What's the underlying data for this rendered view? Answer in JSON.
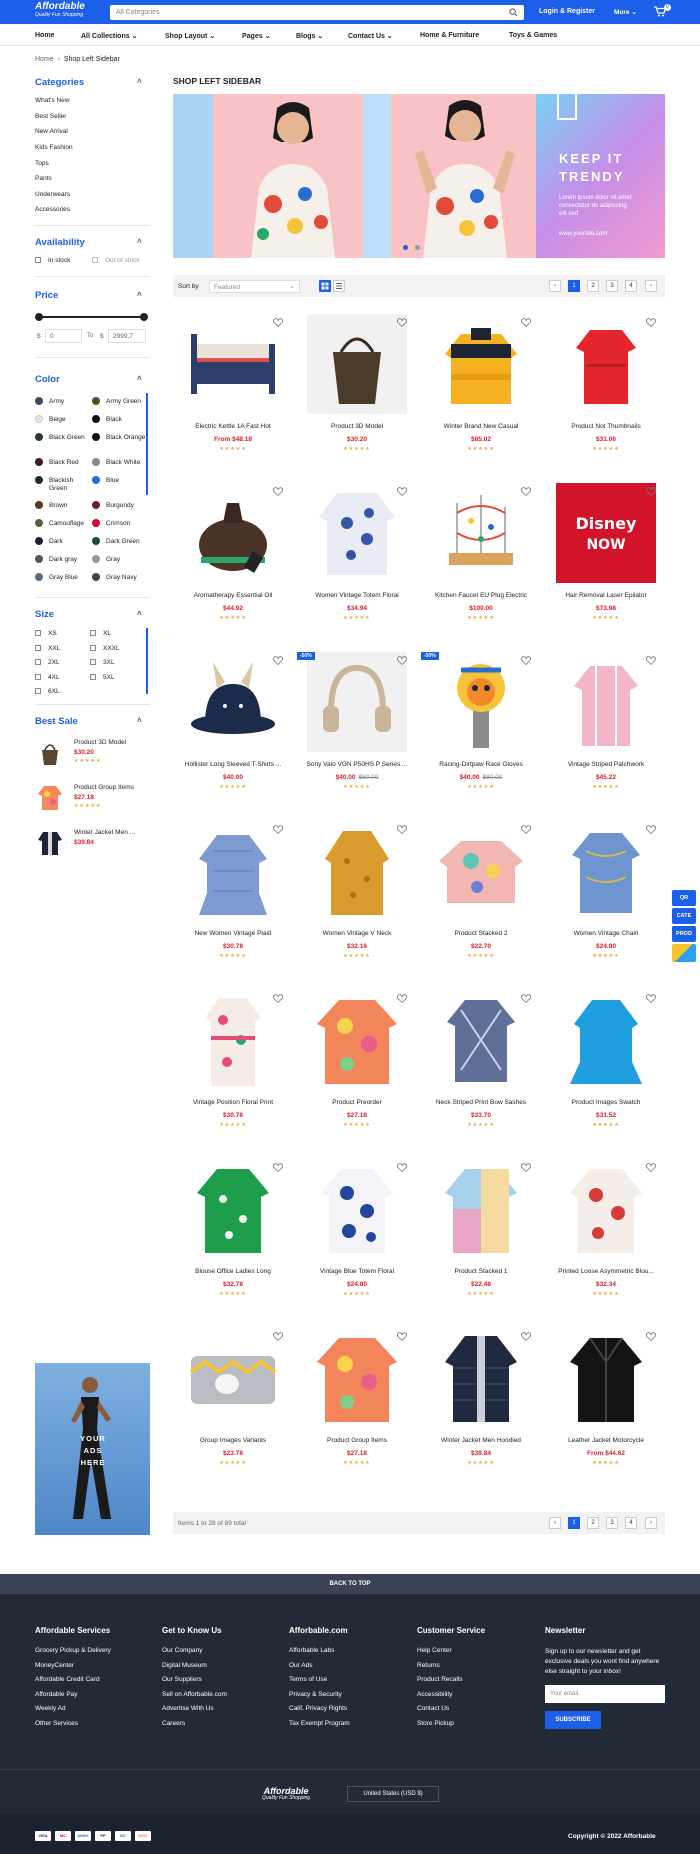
{
  "header": {
    "logo": "Affordable",
    "tagline": "Quality Fun Shopping",
    "search_placeholder": "All Categories",
    "login": "Login & Register",
    "more": "More",
    "cart_count": "0"
  },
  "nav": [
    "Home",
    "All Collections",
    "Shop Layout",
    "Pages",
    "Blogs",
    "Contact Us",
    "Home & Furniture",
    "Toys & Games"
  ],
  "breadcrumb": {
    "home": "Home",
    "current": "Shop Left Sidebar"
  },
  "sidebar": {
    "categories_title": "Categories",
    "categories": [
      "What's New",
      "Best Seller",
      "New Arrival",
      "Kids Fashion",
      "Tops",
      "Pants",
      "Underwears",
      "Accessories"
    ],
    "availability_title": "Availability",
    "in_stock": "In stock",
    "out_of_stock": "Out of stock",
    "price_title": "Price",
    "price_min": "0",
    "price_to": "To",
    "price_max": "2999,7",
    "currency": "$",
    "color_title": "Color",
    "colors": [
      {
        "name": "Army",
        "hex": "#3c4a60"
      },
      {
        "name": "Army Green",
        "hex": "#4b5320"
      },
      {
        "name": "Beige",
        "hex": "#efe3d6"
      },
      {
        "name": "Black",
        "hex": "#111111"
      },
      {
        "name": "Black Green",
        "hex": "#2c3a35"
      },
      {
        "name": "Black Orange",
        "hex": "#111111"
      },
      {
        "name": "Black Red",
        "hex": "#3a1d1d"
      },
      {
        "name": "Black White",
        "hex": "#8a8a8a"
      },
      {
        "name": "Blackish Green",
        "hex": "#1e2b26"
      },
      {
        "name": "Blue",
        "hex": "#1f6fe0"
      },
      {
        "name": "Brown",
        "hex": "#5a3a1e"
      },
      {
        "name": "Burgundy",
        "hex": "#6b1f2a"
      },
      {
        "name": "Camouflage",
        "hex": "#5d5b44"
      },
      {
        "name": "Crimson",
        "hex": "#c8102e"
      },
      {
        "name": "Dark",
        "hex": "#1d2230"
      },
      {
        "name": "Dark Green",
        "hex": "#1f4a2b"
      },
      {
        "name": "Dark gray",
        "hex": "#555555"
      },
      {
        "name": "Gray",
        "hex": "#9a9a9a"
      },
      {
        "name": "Gray Blue",
        "hex": "#5a6b80"
      },
      {
        "name": "Gray Navy",
        "hex": "#3b4556"
      }
    ],
    "size_title": "Size",
    "sizes": [
      "XS",
      "XL",
      "XXL",
      "XXXL",
      "2XL",
      "3XL",
      "4XL",
      "5XL",
      "6XL"
    ],
    "best_sale_title": "Best Sale",
    "best_sale": [
      {
        "name": "Product 3D Model",
        "price": "$30.20"
      },
      {
        "name": "Product Group Items",
        "price": "$27.18"
      },
      {
        "name": "Winter Jacket Men ...",
        "price": "$39.84"
      }
    ],
    "ads": "YOUR ADS HERE"
  },
  "page_title": "SHOP LEFT SIDEBAR",
  "banner": {
    "headline": "KEEP IT TRENDY",
    "body": "Lorem ipsum dolor sit amet consectetur do adipiscing elit sed",
    "url": "www.yoursite.com"
  },
  "toolbar": {
    "sort_label": "Sort by",
    "sort_value": "Featured",
    "pages": [
      "1",
      "2",
      "3",
      "4"
    ]
  },
  "products": [
    {
      "name": "Electric Kettle 1A Fast Hot",
      "price": "$48.18",
      "from": "From"
    },
    {
      "name": "Product 3D Model",
      "price": "$30.20"
    },
    {
      "name": "Winter Brand New Casual",
      "price": "$85.02"
    },
    {
      "name": "Product Not Thumbnails",
      "price": "$31.06"
    },
    {
      "name": "Aromatherapy Essential Oil",
      "price": "$44.92"
    },
    {
      "name": "Women Vintage Totem Floral",
      "price": "$34.94"
    },
    {
      "name": "Kitchen Faucet EU Plug Electric",
      "price": "$100.00"
    },
    {
      "name": "Hair Removal Laser Epilator",
      "price": "$73.98"
    },
    {
      "name": "Hollister Long Sleeved T-Shirts ...",
      "price": "$40.00"
    },
    {
      "name": "Sony Vaio VGN P50HS P Series ...",
      "price": "$40.00",
      "old": "$80.00",
      "badge": "-50%"
    },
    {
      "name": "Racing-Dirtpaw Race Gloves",
      "price": "$40.00",
      "old": "$80.00",
      "badge": "-50%"
    },
    {
      "name": "Vintage Striped Patchwork",
      "price": "$45.22"
    },
    {
      "name": "New Women Vintage Plaid",
      "price": "$30.78"
    },
    {
      "name": "Women Vintage V Neck",
      "price": "$32.16"
    },
    {
      "name": "Product Stacked 2",
      "price": "$22.70"
    },
    {
      "name": "Women Vintage Chain",
      "price": "$24.80"
    },
    {
      "name": "Vintage Position Floral Print",
      "price": "$30.78"
    },
    {
      "name": "Product Preorder",
      "price": "$27.18"
    },
    {
      "name": "Neck Striped Print Bow Sashes",
      "price": "$33.70"
    },
    {
      "name": "Product Images Swatch",
      "price": "$31.52"
    },
    {
      "name": "Blouse Office Ladies Long",
      "price": "$32.78"
    },
    {
      "name": "Vintage Blue Totem Floral",
      "price": "$24.80"
    },
    {
      "name": "Product Stacked 1",
      "price": "$22.48"
    },
    {
      "name": "Printed Loose Asymmetric Blou...",
      "price": "$32.34"
    },
    {
      "name": "Group Images Variants",
      "price": "$23.78"
    },
    {
      "name": "Product Group Items",
      "price": "$27.18"
    },
    {
      "name": "Winter Jacket Men Hoodied",
      "price": "$39.84"
    },
    {
      "name": "Leather Jacket Motorcycle",
      "price": "$44.62",
      "from": "From"
    }
  ],
  "bottombar": {
    "total": "Items 1 to 28 of 89 total"
  },
  "floating": [
    "QR",
    "CATE",
    "PROD"
  ],
  "footer": {
    "back_to_top": "BACK TO TOP",
    "cols": [
      {
        "title": "Affordable Services",
        "links": [
          "Grocery Pickup & Delivery",
          "MoneyCenter",
          "Affordable Credit Card",
          "Affordable Pay",
          "Weekly Ad",
          "Other Services"
        ]
      },
      {
        "title": "Get to Know Us",
        "links": [
          "Our Company",
          "Digital Museum",
          "Our Suppliers",
          "Sell on Afforbable.com",
          "Advertise With Us",
          "Careers"
        ]
      },
      {
        "title": "Afforbable.com",
        "links": [
          "Afforbable Labs",
          "Our Ads",
          "Terms of Use",
          "Privacy & Security",
          "Calif. Privacy Rights",
          "Tax Exempt Program"
        ]
      },
      {
        "title": "Customer Service",
        "links": [
          "Help Center",
          "Returns",
          "Product Recalls",
          "Accessibility",
          "Contact Us",
          "Store Pickup"
        ]
      }
    ],
    "newsletter_title": "Newsletter",
    "newsletter_text": "Sign up to our newsletter and get exclusive deals you wont find anywhere else straight to your inbox!",
    "email_placeholder": "Your email",
    "subscribe": "SUBSCRIBE",
    "logo": "Affordable",
    "tagline": "Quality Fun Shopping",
    "currency": "United States (USD $)",
    "copyright": "Copyright © 2022 Afforbable",
    "payments": [
      "VISA",
      "MC",
      "AMEX",
      "PP",
      "DC",
      "DISC"
    ]
  }
}
